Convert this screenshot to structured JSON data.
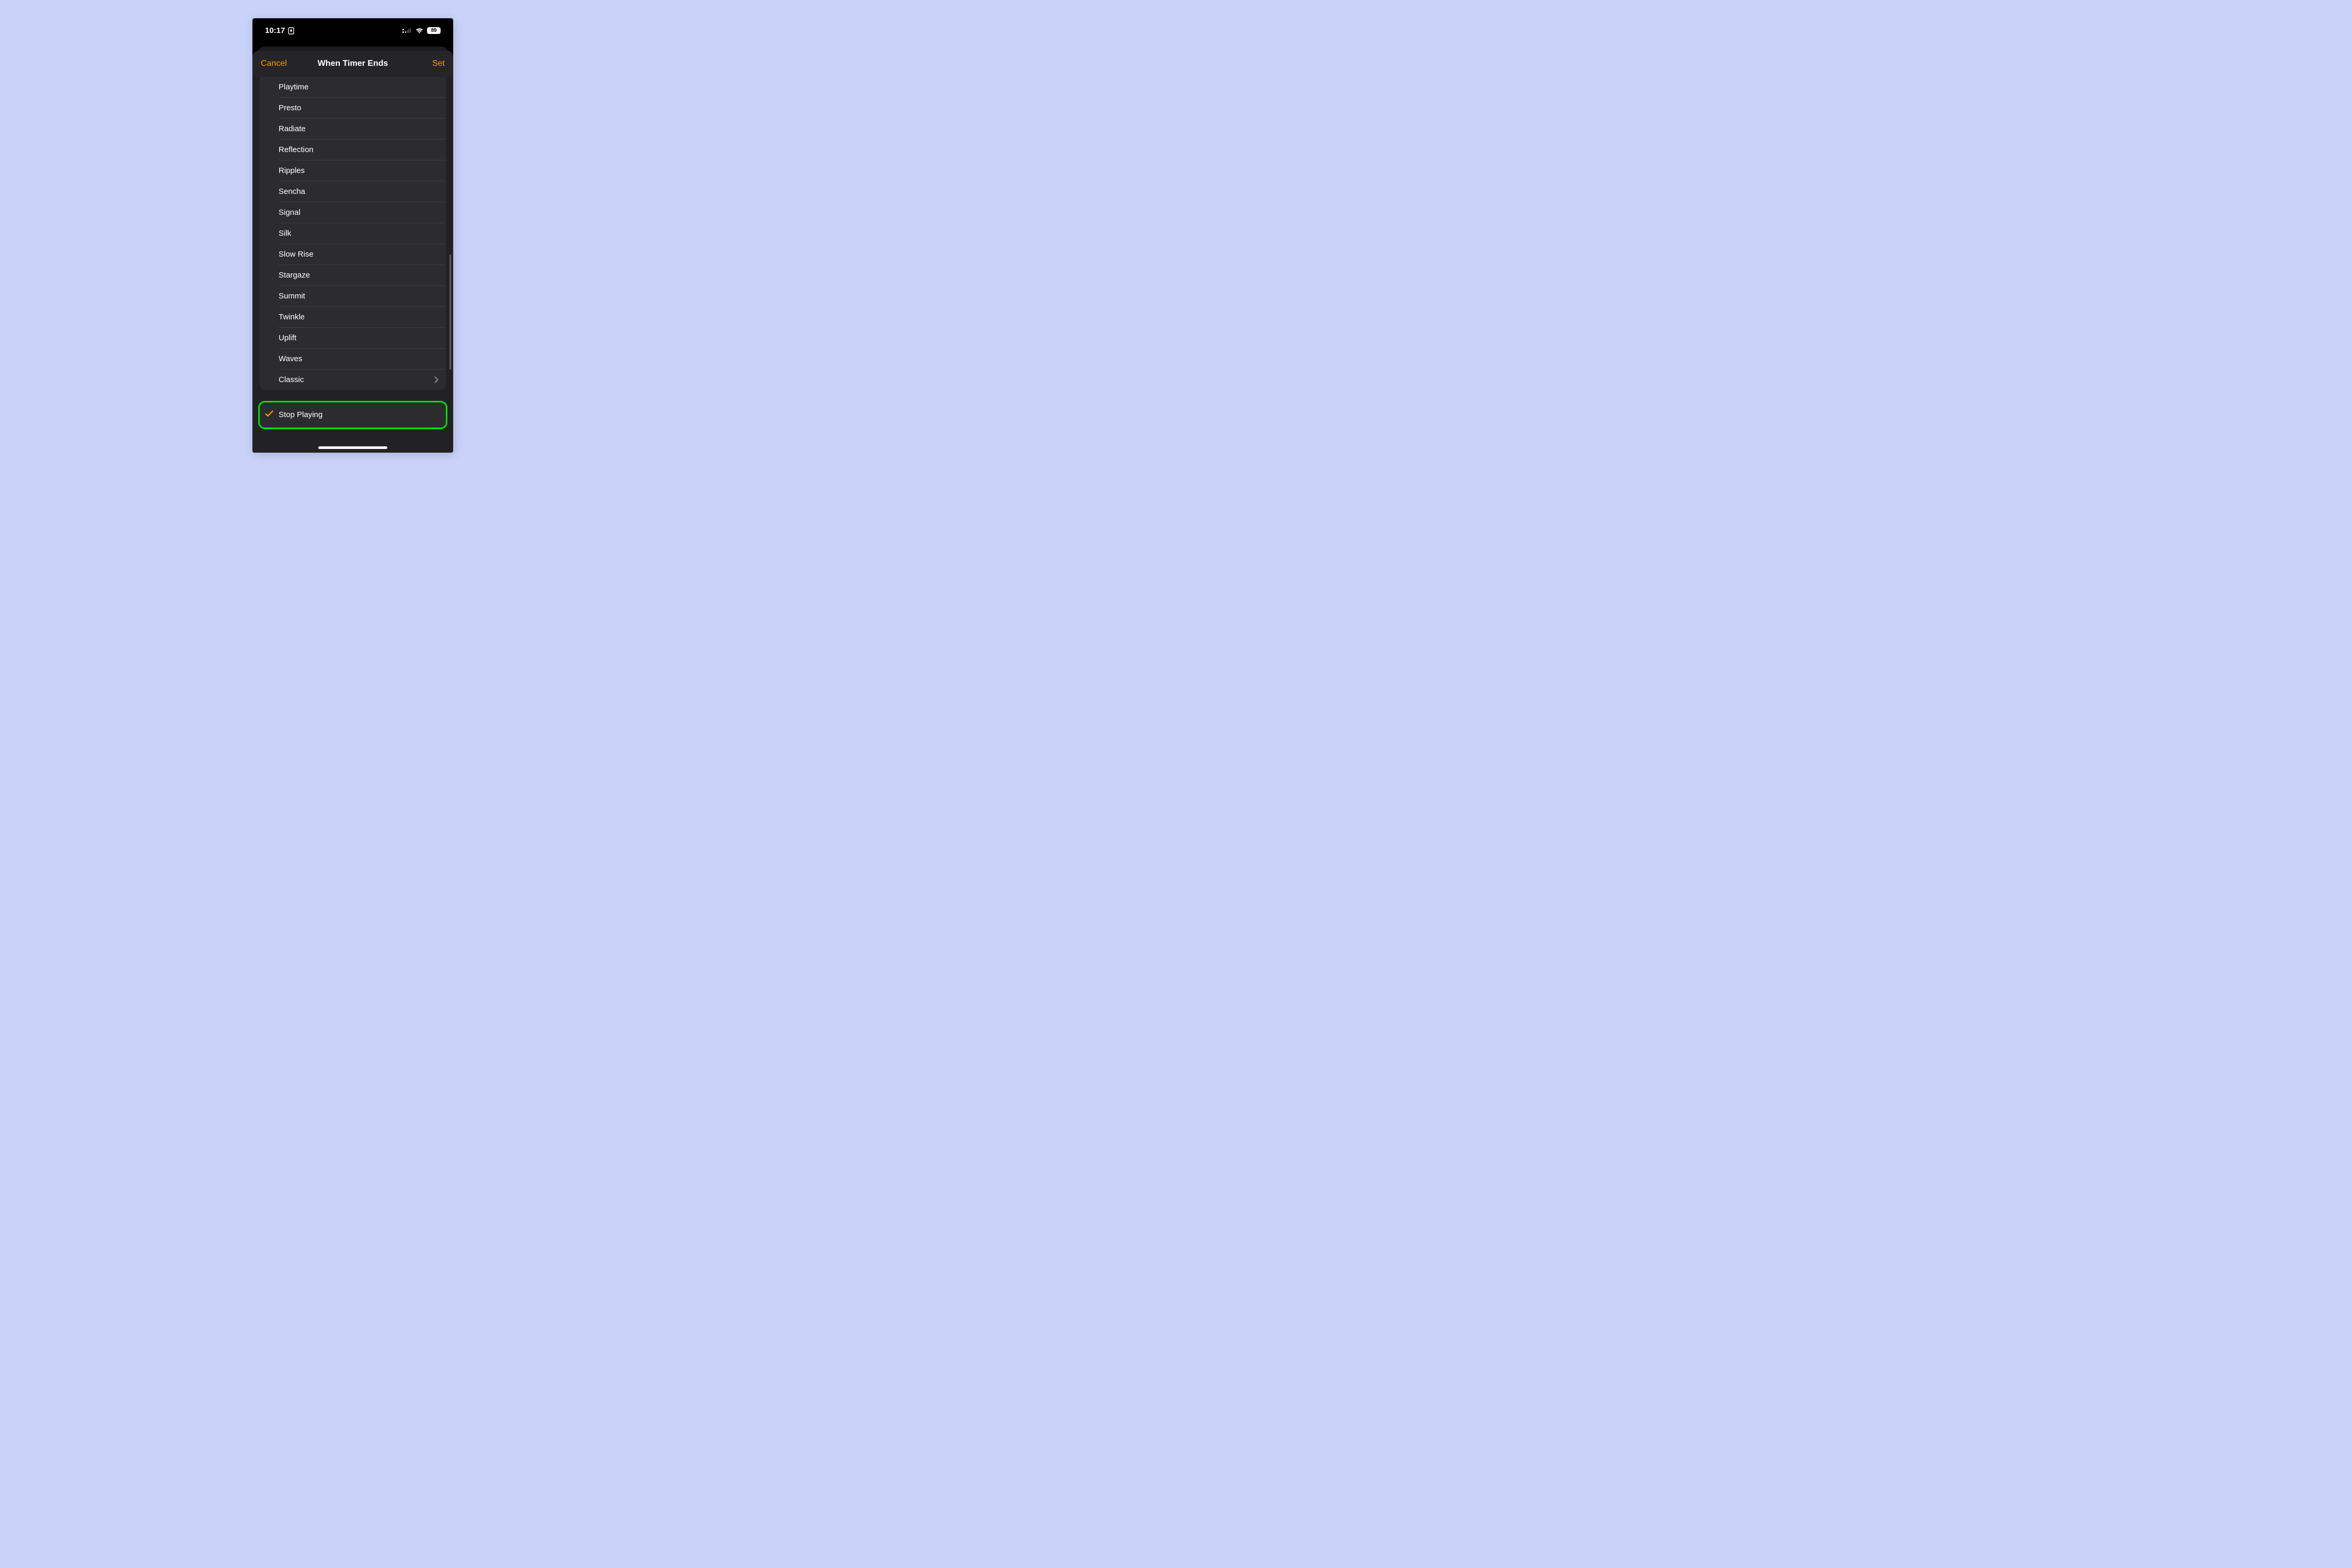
{
  "status": {
    "time": "10:17",
    "battery": "89"
  },
  "nav": {
    "cancel": "Cancel",
    "title": "When Timer Ends",
    "set": "Set"
  },
  "sounds": [
    {
      "label": "Playtime"
    },
    {
      "label": "Presto"
    },
    {
      "label": "Radiate"
    },
    {
      "label": "Reflection"
    },
    {
      "label": "Ripples"
    },
    {
      "label": "Sencha"
    },
    {
      "label": "Signal"
    },
    {
      "label": "Silk"
    },
    {
      "label": "Slow Rise"
    },
    {
      "label": "Stargaze"
    },
    {
      "label": "Summit"
    },
    {
      "label": "Twinkle"
    },
    {
      "label": "Uplift"
    },
    {
      "label": "Waves"
    },
    {
      "label": "Classic",
      "disclosure": true
    }
  ],
  "stop": {
    "label": "Stop Playing",
    "selected": true
  },
  "colors": {
    "accent": "#FF9500",
    "highlight": "#00E000"
  }
}
